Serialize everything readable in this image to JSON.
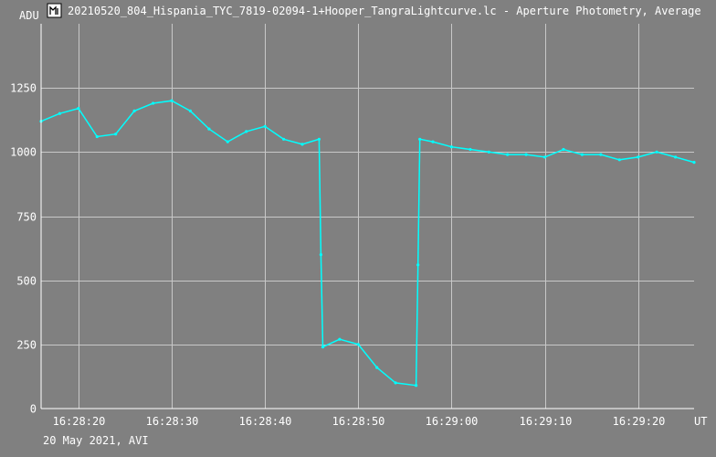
{
  "window": {
    "icon": "tangra-app-icon",
    "title": "20210520_804_Hispania_TYC_7819-02094-1+Hooper_TangraLightcurve.lc - Aperture Photometry, Average"
  },
  "footer": {
    "date_label": "20 May 2021, AVI"
  },
  "colors": {
    "background": "#808080",
    "series": "#00ffff",
    "grid": "#c8c8c8",
    "text": "#ffffff"
  },
  "chart_data": {
    "type": "line",
    "title": "",
    "ylabel": "ADU",
    "xlabel": "UT",
    "grid": true,
    "legend": "none",
    "xlim": [
      "16:28:16",
      "16:29:26"
    ],
    "ylim": [
      0,
      1500
    ],
    "yticks": [
      0,
      250,
      500,
      750,
      1000,
      1250
    ],
    "yticklabels": [
      "0",
      "250",
      "500",
      "750",
      "1000",
      "1250"
    ],
    "xticks": [
      "16:28:20",
      "16:28:30",
      "16:28:40",
      "16:28:50",
      "16:29:00",
      "16:29:10",
      "16:29:20"
    ],
    "series": [
      {
        "color": "#00ffff",
        "x": [
          "16:28:16",
          "16:28:18",
          "16:28:20",
          "16:28:22",
          "16:28:24",
          "16:28:26",
          "16:28:28",
          "16:28:30",
          "16:28:32",
          "16:28:34",
          "16:28:36",
          "16:28:38",
          "16:28:40",
          "16:28:42",
          "16:28:44",
          "16:28:45.8",
          "16:28:46.0",
          "16:28:46.2",
          "16:28:48",
          "16:28:50",
          "16:28:52",
          "16:28:54",
          "16:28:56.2",
          "16:28:56.4",
          "16:28:56.6",
          "16:28:58",
          "16:29:00",
          "16:29:02",
          "16:29:04",
          "16:29:06",
          "16:29:08",
          "16:29:10",
          "16:29:12",
          "16:29:14",
          "16:29:16",
          "16:29:18",
          "16:29:20",
          "16:29:22",
          "16:29:24",
          "16:29:26"
        ],
        "values": [
          1120,
          1150,
          1170,
          1060,
          1070,
          1160,
          1190,
          1200,
          1160,
          1090,
          1040,
          1080,
          1100,
          1050,
          1030,
          1050,
          600,
          240,
          270,
          250,
          160,
          100,
          90,
          560,
          1050,
          1040,
          1020,
          1010,
          1000,
          990,
          990,
          980,
          1010,
          990,
          990,
          970,
          980,
          1000,
          980,
          960
        ]
      }
    ]
  }
}
